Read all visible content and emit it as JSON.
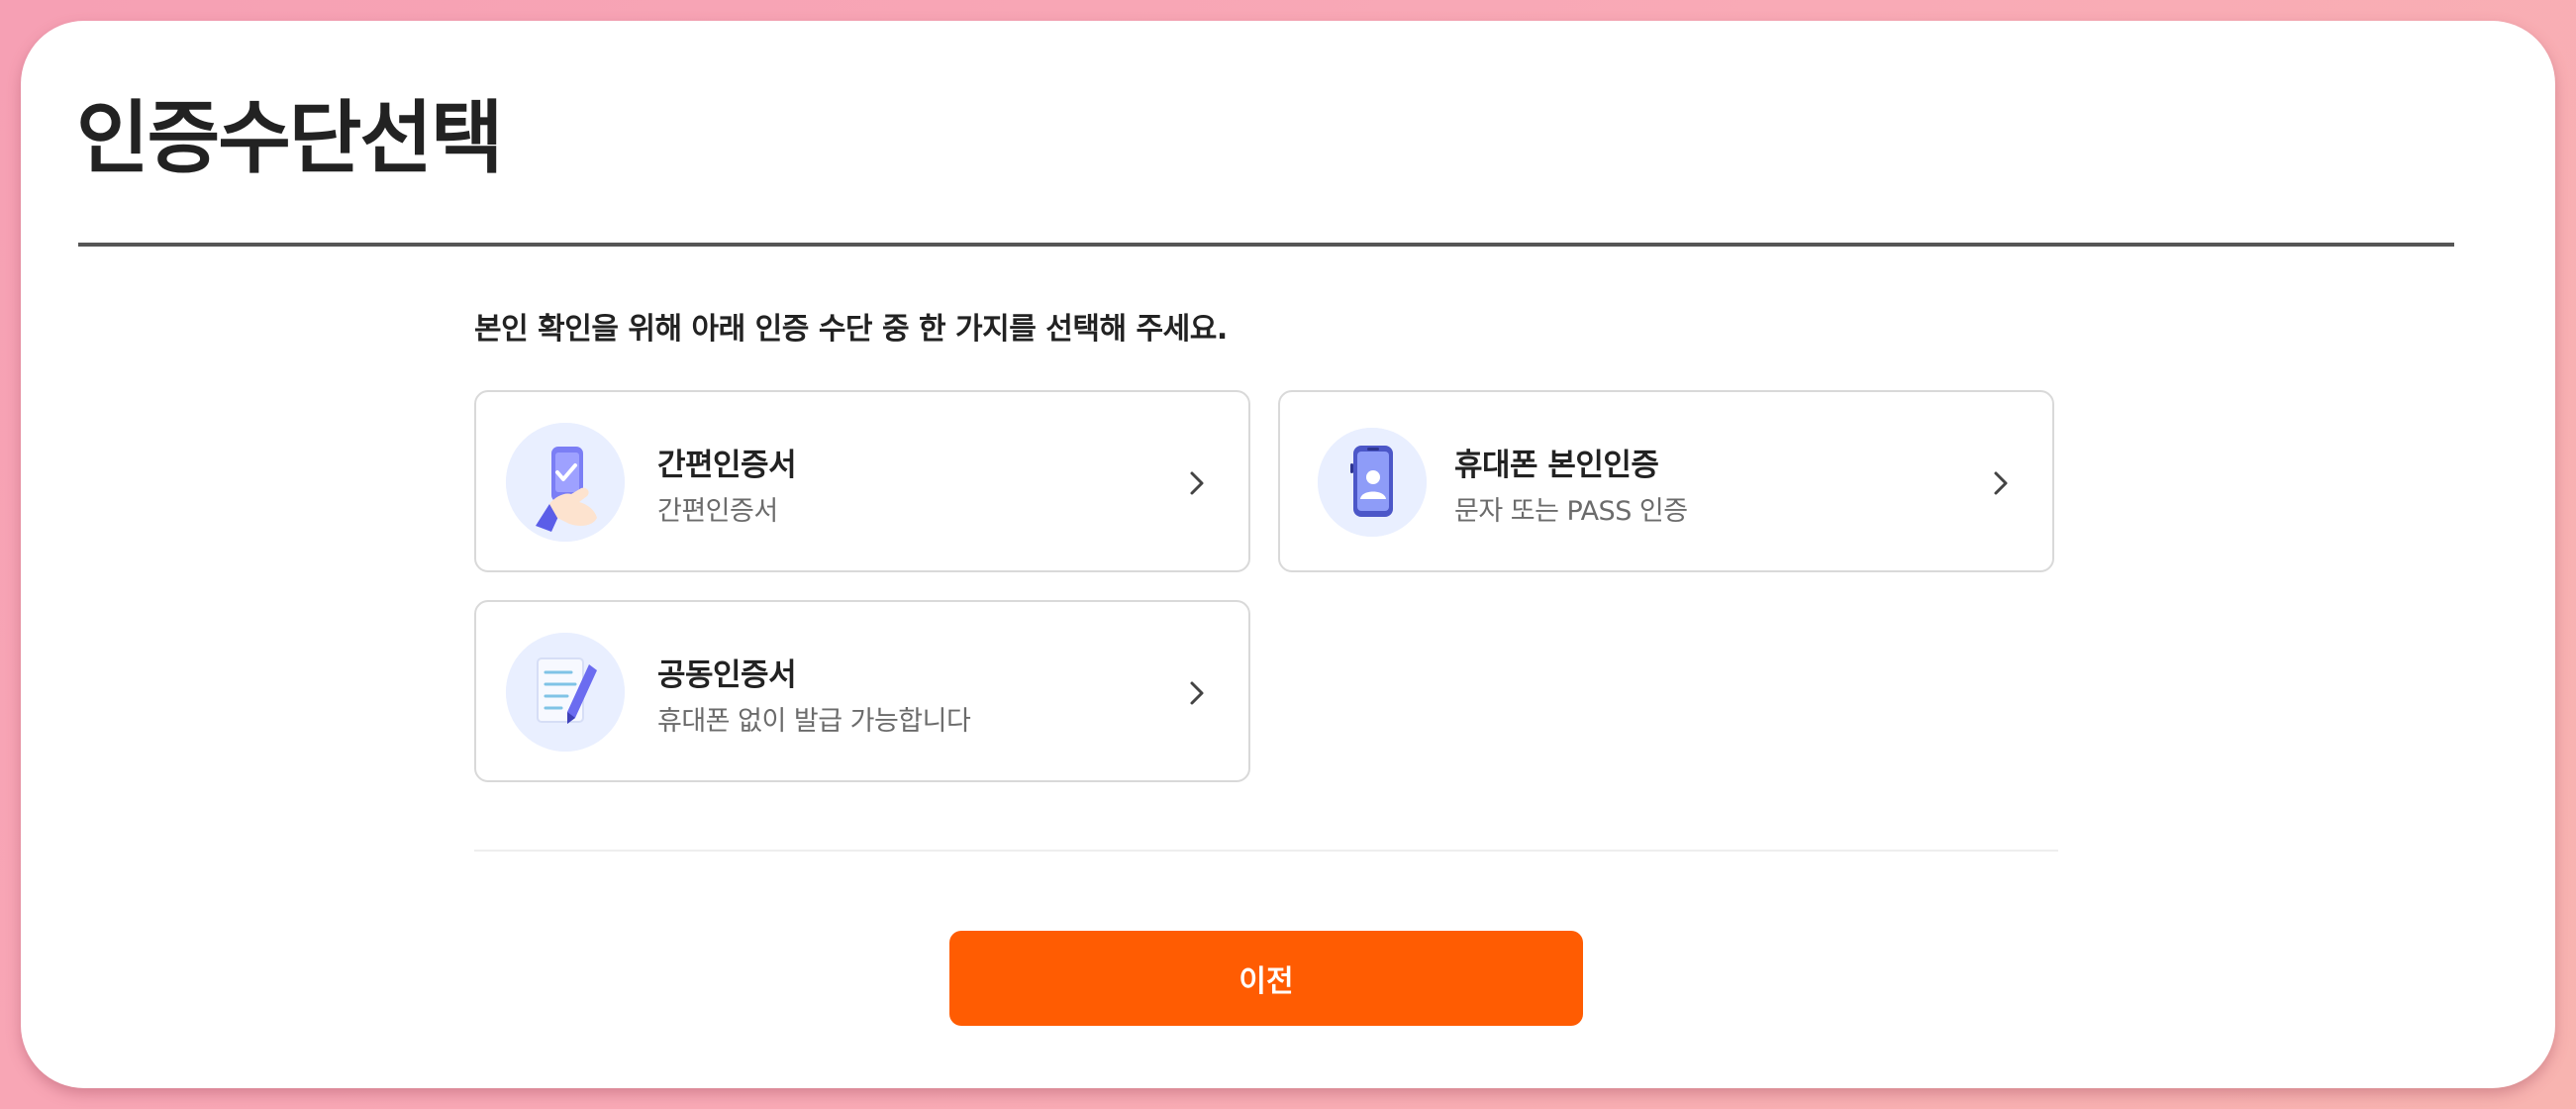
{
  "page": {
    "title": "인증수단선택",
    "instruction": "본인 확인을 위해 아래 인증 수단 중 한 가지를 선택해 주세요."
  },
  "methods": [
    {
      "title": "간편인증서",
      "description": "간편인증서",
      "icon": "hand-holding-phone-check-icon"
    },
    {
      "title": "휴대폰 본인인증",
      "description": "문자 또는 PASS 인증",
      "icon": "mobile-phone-person-icon"
    },
    {
      "title": "공동인증서",
      "description": "휴대폰 없이 발급 가능합니다",
      "icon": "document-pen-icon"
    }
  ],
  "footer": {
    "prev_label": "이전"
  },
  "colors": {
    "accent": "#ff5c02",
    "icon_background": "#e9efff",
    "icon_primary": "#6b6cf0",
    "background_gradient": [
      "#f6a0b4",
      "#f8b4b0"
    ]
  }
}
